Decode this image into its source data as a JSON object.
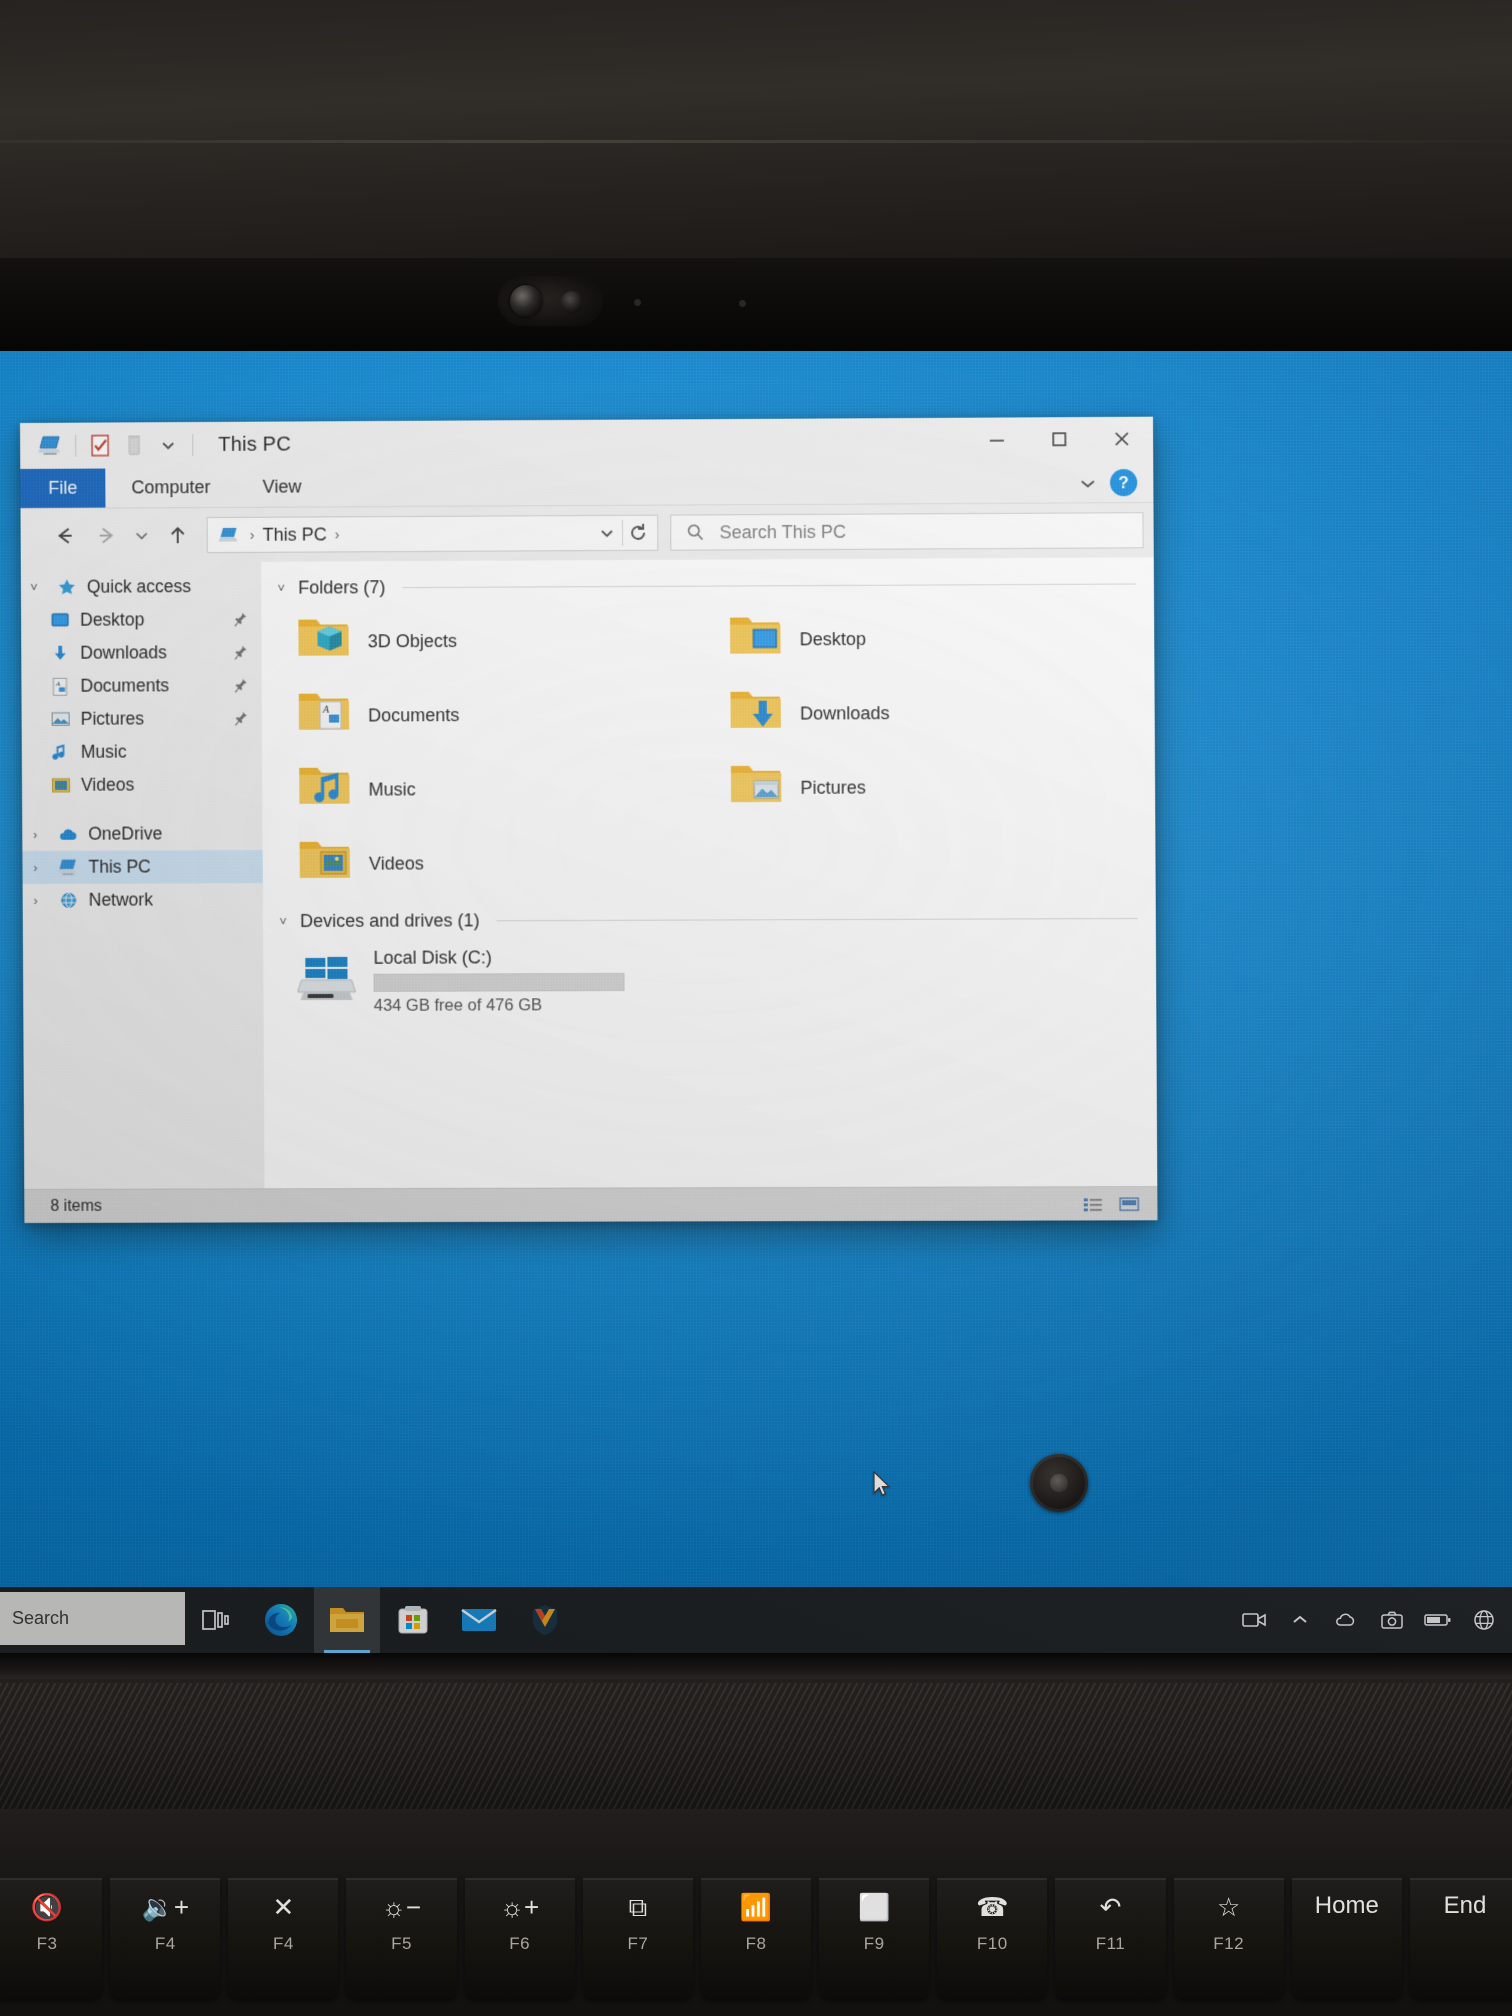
{
  "window": {
    "title": "This PC",
    "quick_access_toolbar": [
      {
        "name": "this-pc-icon",
        "label": "This PC"
      },
      {
        "name": "properties-icon",
        "label": "Properties"
      },
      {
        "name": "delete-icon",
        "label": "Delete"
      },
      {
        "name": "customize-qat-icon",
        "label": "Customize Quick Access Toolbar"
      }
    ],
    "controls": {
      "minimize": "─",
      "maximize": "□",
      "close": "✕"
    },
    "ribbon": {
      "tabs": [
        "File",
        "Computer",
        "View"
      ],
      "active_tab": "File",
      "collapse_label": "˅",
      "help_label": "?"
    },
    "nav": {
      "back": "←",
      "forward": "→",
      "recent": "˅",
      "up": "↑",
      "breadcrumb": [
        "This PC"
      ],
      "breadcrumb_sep": "›",
      "dropdown": "˅",
      "refresh": "↻"
    },
    "search": {
      "placeholder": "Search This PC",
      "value": ""
    },
    "sidebar": {
      "items": [
        {
          "label": "Quick access",
          "icon": "star-icon",
          "chevron": "˅",
          "pinned": false,
          "indent": false,
          "selected": false
        },
        {
          "label": "Desktop",
          "icon": "desktop-icon",
          "chevron": "",
          "pinned": true,
          "indent": true,
          "selected": false
        },
        {
          "label": "Downloads",
          "icon": "downloads-icon",
          "chevron": "",
          "pinned": true,
          "indent": true,
          "selected": false
        },
        {
          "label": "Documents",
          "icon": "documents-icon",
          "chevron": "",
          "pinned": true,
          "indent": true,
          "selected": false
        },
        {
          "label": "Pictures",
          "icon": "pictures-icon",
          "chevron": "",
          "pinned": true,
          "indent": true,
          "selected": false
        },
        {
          "label": "Music",
          "icon": "music-icon",
          "chevron": "",
          "pinned": false,
          "indent": true,
          "selected": false
        },
        {
          "label": "Videos",
          "icon": "videos-icon",
          "chevron": "",
          "pinned": false,
          "indent": true,
          "selected": false
        },
        {
          "label": "OneDrive",
          "icon": "onedrive-icon",
          "chevron": "›",
          "pinned": false,
          "indent": false,
          "selected": false
        },
        {
          "label": "This PC",
          "icon": "this-pc-icon",
          "chevron": "›",
          "pinned": false,
          "indent": false,
          "selected": true
        },
        {
          "label": "Network",
          "icon": "network-icon",
          "chevron": "›",
          "pinned": false,
          "indent": false,
          "selected": false
        }
      ]
    },
    "content": {
      "folders_group": {
        "label": "Folders (7)",
        "chevron": "˅"
      },
      "folders": [
        {
          "label": "3D Objects",
          "icon": "folder-3d-objects-icon"
        },
        {
          "label": "Documents",
          "icon": "folder-documents-icon"
        },
        {
          "label": "Music",
          "icon": "folder-music-icon"
        },
        {
          "label": "Videos",
          "icon": "folder-videos-icon"
        },
        {
          "label": "Desktop",
          "icon": "folder-desktop-icon"
        },
        {
          "label": "Downloads",
          "icon": "folder-downloads-icon"
        },
        {
          "label": "Pictures",
          "icon": "folder-pictures-icon"
        }
      ],
      "drives_group": {
        "label": "Devices and drives (1)",
        "chevron": "˅"
      },
      "drives": [
        {
          "name": "Local Disk (C:)",
          "free_text": "434 GB free of 476 GB",
          "free_gb": 434,
          "total_gb": 476,
          "used_percent": 9,
          "icon": "windows-drive-icon",
          "bar_color": "#0b7fc7"
        }
      ]
    },
    "status": {
      "item_count": "8 items",
      "view_details": "details-view-icon",
      "view_large_icons": "large-icons-view-icon"
    }
  },
  "taskbar": {
    "search_placeholder": "Search",
    "buttons": [
      {
        "name": "task-view-button",
        "label": "Task View",
        "active": false
      },
      {
        "name": "microsoft-edge-button",
        "label": "Microsoft Edge",
        "active": false
      },
      {
        "name": "file-explorer-button",
        "label": "File Explorer",
        "active": true
      },
      {
        "name": "microsoft-store-button",
        "label": "Microsoft Store",
        "active": false
      },
      {
        "name": "mail-button",
        "label": "Mail",
        "active": false
      },
      {
        "name": "mcafee-button",
        "label": "McAfee",
        "active": false
      }
    ],
    "tray": [
      {
        "name": "meet-now-icon",
        "label": "Meet Now"
      },
      {
        "name": "show-hidden-icons-icon",
        "label": "˄"
      },
      {
        "name": "onedrive-tray-icon",
        "label": "OneDrive"
      },
      {
        "name": "camera-privacy-icon",
        "label": "Camera"
      },
      {
        "name": "battery-icon",
        "label": "Battery"
      },
      {
        "name": "network-tray-icon",
        "label": "Network"
      }
    ]
  },
  "keyboard": {
    "keys": [
      {
        "glyph": "🔇",
        "sub": "F3"
      },
      {
        "glyph": "🔉+",
        "sub": "F4"
      },
      {
        "glyph": "✕",
        "sub": "F4"
      },
      {
        "glyph": "☼−",
        "sub": "F5"
      },
      {
        "glyph": "☼+",
        "sub": "F6"
      },
      {
        "glyph": "⧉",
        "sub": "F7"
      },
      {
        "glyph": "📶",
        "sub": "F8"
      },
      {
        "glyph": "⬜",
        "sub": "F9"
      },
      {
        "glyph": "☎",
        "sub": "F10"
      },
      {
        "glyph": "↶",
        "sub": "F11"
      },
      {
        "glyph": "☆",
        "sub": "F12"
      },
      {
        "glyph": "Home",
        "sub": ""
      },
      {
        "glyph": "End",
        "sub": ""
      }
    ]
  },
  "colors": {
    "accent": "#0b7fc7",
    "desktop_blue": "#0d8ad4",
    "file_tab": "#1565c0",
    "selection": "#cce3f5",
    "window_chrome": "#f0f0f0",
    "taskbar": "#1f2326"
  }
}
